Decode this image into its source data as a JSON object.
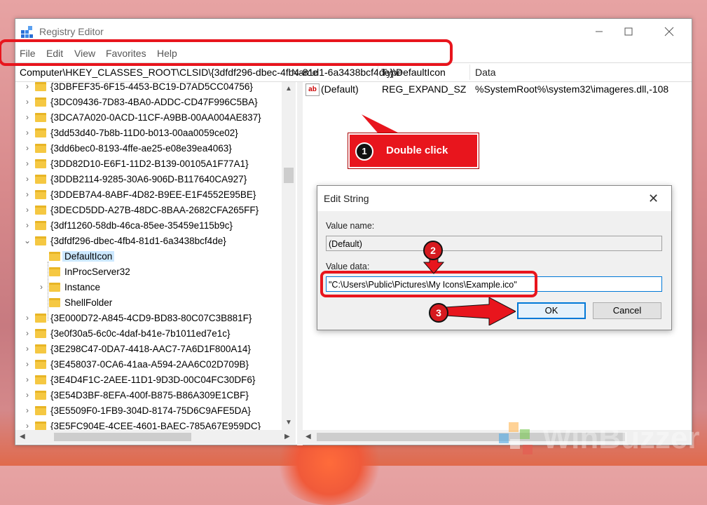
{
  "window": {
    "title": "Registry Editor"
  },
  "menu": [
    "File",
    "Edit",
    "View",
    "Favorites",
    "Help"
  ],
  "address": "Computer\\HKEY_CLASSES_ROOT\\CLSID\\{3dfdf296-dbec-4fb4-81d1-6a3438bcf4de}\\DefaultIcon",
  "tree": [
    "{3DBFEF35-6F15-4453-BC19-D7AD5CC04756}",
    "{3DC09436-7D83-4BA0-ADDC-CD47F996C5BA}",
    "{3DCA7A020-0ACD-11CF-A9BB-00AA004AE837}",
    "{3dd53d40-7b8b-11D0-b013-00aa0059ce02}",
    "{3dd6bec0-8193-4ffe-ae25-e08e39ea4063}",
    "{3DD82D10-E6F1-11D2-B139-00105A1F77A1}",
    "{3DDB2114-9285-30A6-906D-B117640CA927}",
    "{3DDEB7A4-8ABF-4D82-B9EE-E1F4552E95BE}",
    "{3DECD5DD-A27B-48DC-8BAA-2682CFA265FF}",
    "{3df11260-58db-46ca-85ee-35459e115b9c}",
    "{3dfdf296-dbec-4fb4-81d1-6a3438bcf4de}",
    "DefaultIcon",
    "InProcServer32",
    "Instance",
    "ShellFolder",
    "{3E000D72-A845-4CD9-BD83-80C07C3B881F}",
    "{3e0f30a5-6c0c-4daf-b41e-7b1011ed7e1c}",
    "{3E298C47-0DA7-4418-AAC7-7A6D1F800A14}",
    "{3E458037-0CA6-41aa-A594-2AA6C02D709B}",
    "{3E4D4F1C-2AEE-11D1-9D3D-00C04FC30DF6}",
    "{3E54D3BF-8EFA-400f-B875-B86A309E1CBF}",
    "{3E5509F0-1FB9-304D-8174-75D6C9AFE5DA}",
    "{3E5FC904E-4CEE-4601-BAEC-785A67E959DC}"
  ],
  "list": {
    "headers": [
      "Name",
      "Type",
      "Data"
    ],
    "row": {
      "name": "(Default)",
      "type": "REG_EXPAND_SZ",
      "data": "%SystemRoot%\\system32\\imageres.dll,-108"
    }
  },
  "callout": {
    "step1_num": "1",
    "step1_text": "Double click",
    "step2_num": "2",
    "step3_num": "3"
  },
  "dialog": {
    "title": "Edit String",
    "value_name_label": "Value name:",
    "value_name": "(Default)",
    "value_data_label": "Value data:",
    "value_data": "\"C:\\Users\\Public\\Pictures\\My Icons\\Example.ico\"",
    "ok": "OK",
    "cancel": "Cancel"
  },
  "watermark": "WinBuzzer",
  "colors": {
    "highlight": "#e8151d",
    "accent": "#0078d7",
    "folder": "#f5c842"
  }
}
